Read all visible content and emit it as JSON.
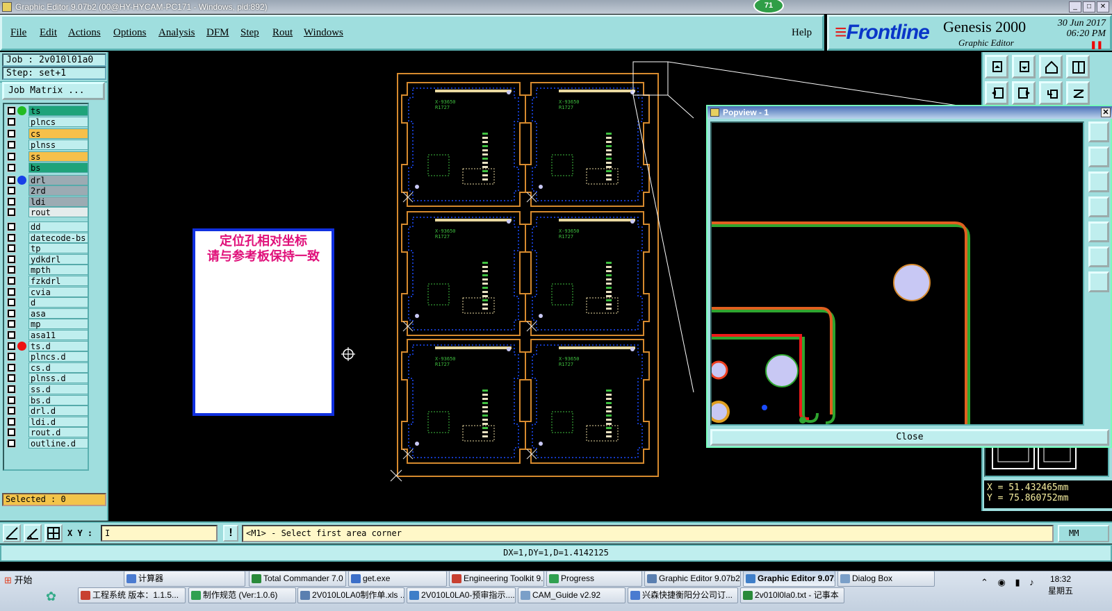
{
  "window": {
    "title": "Graphic Editor 9.07b2 (00@HY-HYCAM-PC171 - Windows, pid:892)",
    "badge": "71"
  },
  "menu": {
    "items": [
      "File",
      "Edit",
      "Actions",
      "Options",
      "Analysis",
      "DFM",
      "Step",
      "Rout",
      "Windows"
    ],
    "help": "Help"
  },
  "brand": {
    "logo": "Frontline",
    "product": "Genesis 2000",
    "subtitle": "Graphic Editor",
    "date": "30 Jun 2017",
    "time": "06:20 PM"
  },
  "job": {
    "job_label": "Job : 2v010l01a0",
    "step_label": "Step: set+1",
    "matrix_button": "Job Matrix ..."
  },
  "layers": [
    {
      "name": "ts",
      "color": "#1fa37a",
      "dot": "#22bb22"
    },
    {
      "name": "plncs",
      "color": "#bfeeee",
      "dot": ""
    },
    {
      "name": "cs",
      "color": "#f6c04a",
      "dot": ""
    },
    {
      "name": "plnss",
      "color": "#bfeeee",
      "dot": ""
    },
    {
      "name": "ss",
      "color": "#f6c04a",
      "dot": ""
    },
    {
      "name": "bs",
      "color": "#1fa37a",
      "dot": ""
    },
    {
      "name": "drl",
      "color": "#9cabb3",
      "dot": "#1740e8"
    },
    {
      "name": "2rd",
      "color": "#9cabb3",
      "dot": ""
    },
    {
      "name": "ldi",
      "color": "#9cabb3",
      "dot": ""
    },
    {
      "name": "rout",
      "color": "#e4ecec",
      "dot": ""
    },
    {
      "name": "dd",
      "color": "#bfeeee",
      "dot": ""
    },
    {
      "name": "datecode-bs",
      "color": "#bfeeee",
      "dot": ""
    },
    {
      "name": "tp",
      "color": "#bfeeee",
      "dot": ""
    },
    {
      "name": "ydkdrl",
      "color": "#bfeeee",
      "dot": ""
    },
    {
      "name": "mpth",
      "color": "#bfeeee",
      "dot": ""
    },
    {
      "name": "fzkdrl",
      "color": "#bfeeee",
      "dot": ""
    },
    {
      "name": "cvia",
      "color": "#bfeeee",
      "dot": ""
    },
    {
      "name": "d",
      "color": "#bfeeee",
      "dot": ""
    },
    {
      "name": "asa",
      "color": "#bfeeee",
      "dot": ""
    },
    {
      "name": "mp",
      "color": "#bfeeee",
      "dot": ""
    },
    {
      "name": "asa11",
      "color": "#bfeeee",
      "dot": ""
    },
    {
      "name": "ts.d",
      "color": "#bfeeee",
      "dot": "#ee1111"
    },
    {
      "name": "plncs.d",
      "color": "#bfeeee",
      "dot": ""
    },
    {
      "name": "cs.d",
      "color": "#bfeeee",
      "dot": ""
    },
    {
      "name": "plnss.d",
      "color": "#bfeeee",
      "dot": ""
    },
    {
      "name": "ss.d",
      "color": "#bfeeee",
      "dot": ""
    },
    {
      "name": "bs.d",
      "color": "#bfeeee",
      "dot": ""
    },
    {
      "name": "drl.d",
      "color": "#bfeeee",
      "dot": ""
    },
    {
      "name": "ldi.d",
      "color": "#bfeeee",
      "dot": ""
    },
    {
      "name": "rout.d",
      "color": "#bfeeee",
      "dot": ""
    },
    {
      "name": "outline.d",
      "color": "#bfeeee",
      "dot": ""
    }
  ],
  "selected": "Selected : 0",
  "note": {
    "line1": "定位孔相对坐标",
    "line2": "请与参考板保持一致"
  },
  "pcb": {
    "board_label": "X-93650",
    "board_rev": "R1727"
  },
  "popview": {
    "title": "Popview - 1",
    "close": "Close"
  },
  "coords": {
    "x": "X = 51.432465mm",
    "y": "Y = 75.860752mm"
  },
  "command": {
    "xy_label": "X Y :",
    "xy_value": "I",
    "prompt": "<M1> - Select first area corner",
    "units": "MM"
  },
  "status": "DX=1,DY=1,D=1.4142125",
  "taskbar": {
    "start": "开始",
    "row1": [
      "计算器",
      "Total Commander 7.0 ...",
      "get.exe",
      "Engineering Toolkit 9....",
      "Progress",
      "Graphic Editor 9.07b2...",
      "Graphic Editor 9.07...",
      "Dialog Box"
    ],
    "row2": [
      "工程系统  版本：1.1.5...",
      "制作规范 (Ver:1.0.6)",
      "2V010L0LA0制作单.xls ...",
      "2V010L0LA0-预审指示....",
      "CAM_Guide v2.92",
      "兴森快捷衡阳分公司订...",
      "2v010l0la0.txt - 记事本"
    ],
    "time": "18:32",
    "day": "星期五"
  },
  "colors": {
    "panel": "#9fdede",
    "outline": "#d68a2e",
    "trace": "#1a4cff",
    "silk": "#3fbf3f"
  }
}
